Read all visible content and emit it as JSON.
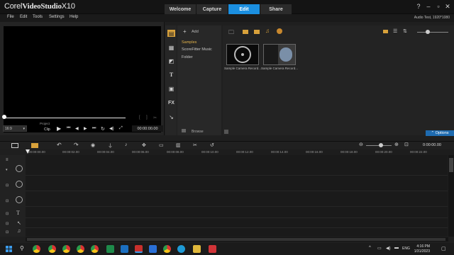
{
  "app": {
    "title_prefix": "Corel",
    "title_brand": "VideoStudio",
    "title_version": "X10"
  },
  "workspace_tabs": [
    "Welcome",
    "Capture",
    "Edit",
    "Share"
  ],
  "active_tab": "Edit",
  "menu": [
    "File",
    "Edit",
    "Tools",
    "Settings",
    "Help"
  ],
  "audio_info": "Audio Test, 1920*1080",
  "preview": {
    "mode_label_project": "Project",
    "mode_label_clip": "Clip",
    "aspect": "16:9",
    "timecode": "00:00:00.00"
  },
  "library": {
    "add_label": "Add",
    "nav_items": [
      "Samples",
      "ScoreFitter Music",
      "Folder"
    ],
    "selected_nav": "Samples",
    "browse_label": "Browse",
    "thumbnails": [
      "Sample Camera Record...",
      "Sample Camera Record..."
    ],
    "options_label": "Options"
  },
  "timeline": {
    "ruler_ticks": [
      "00:00:00.00",
      "00:00:02.00",
      "00:00:04.00",
      "00:00:06.00",
      "00:00:08.00",
      "00:00:10.00",
      "00:00:12.00",
      "00:00:14.00",
      "00:00:16.00",
      "00:00:18.00",
      "00:00:20.00",
      "00:00:22.00"
    ],
    "duration": "0:00:00.00"
  },
  "taskbar": {
    "language": "ENG",
    "time": "4:16 PM",
    "date": "1/31/2023"
  },
  "colors": {
    "accent": "#1b8fe0",
    "selected_nav": "#e2b24a",
    "tool_active": "#d8a13b"
  }
}
